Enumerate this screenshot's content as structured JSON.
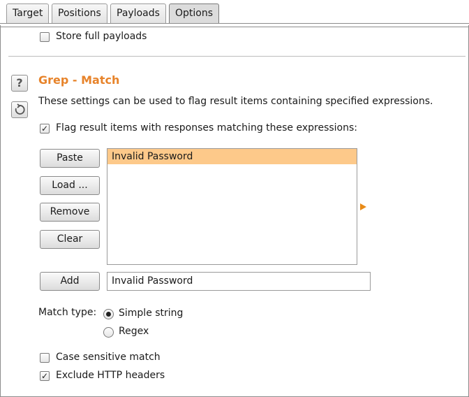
{
  "tabs": [
    {
      "label": "Target"
    },
    {
      "label": "Positions"
    },
    {
      "label": "Payloads"
    },
    {
      "label": "Options",
      "active": true
    }
  ],
  "store_full_payloads": {
    "label": "Store full payloads",
    "checked": false
  },
  "grep_match": {
    "title": "Grep - Match",
    "description": "These settings can be used to flag result items containing specified expressions.",
    "flag_checkbox": {
      "label": "Flag result items with responses matching these expressions:",
      "checked": true
    },
    "buttons": {
      "paste": "Paste",
      "load": "Load ...",
      "remove": "Remove",
      "clear": "Clear",
      "add": "Add"
    },
    "expressions": [
      "Invalid Password"
    ],
    "selected_expression": "Invalid Password",
    "add_input_value": "Invalid Password",
    "match_type": {
      "label": "Match type:",
      "options": [
        {
          "label": "Simple string",
          "selected": true
        },
        {
          "label": "Regex",
          "selected": false
        }
      ]
    },
    "case_sensitive": {
      "label": "Case sensitive match",
      "checked": false
    },
    "exclude_headers": {
      "label": "Exclude HTTP headers",
      "checked": true
    }
  },
  "icons": {
    "help": "help-icon",
    "restore": "restore-defaults-icon"
  },
  "colors": {
    "accent": "#e7832a",
    "selection": "#fdc98a"
  }
}
